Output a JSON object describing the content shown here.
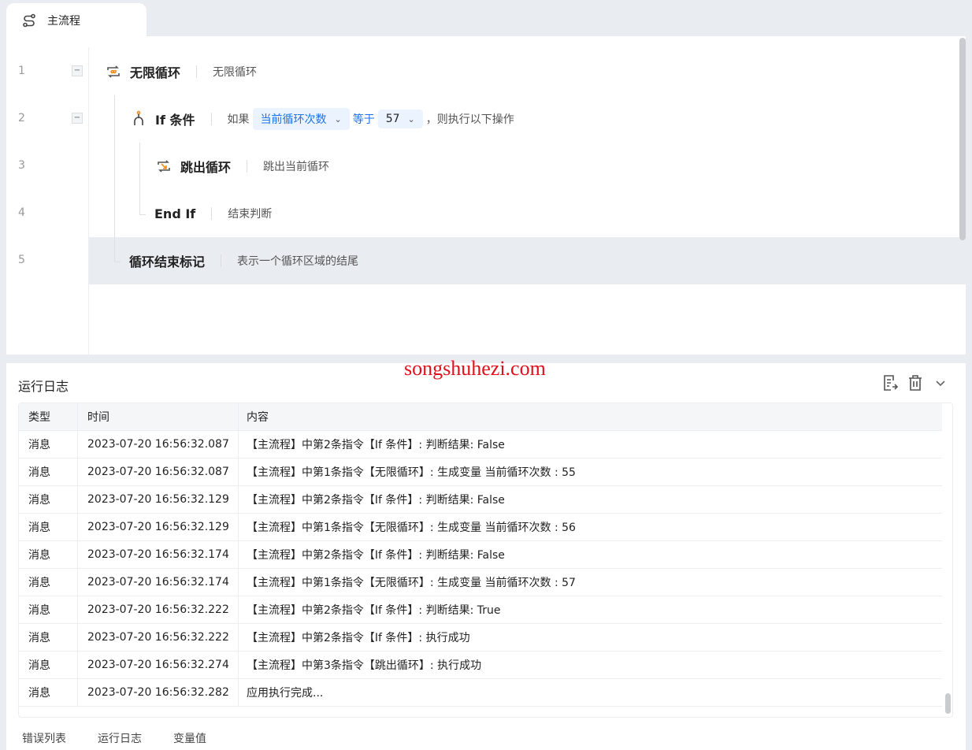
{
  "tab": {
    "label": "主流程",
    "icon": "flow-icon"
  },
  "editor": {
    "rows": [
      {
        "line": "1",
        "name": "无限循环",
        "desc": "无限循环",
        "icon": "infinite-loop-icon"
      },
      {
        "line": "2",
        "name": "If 条件",
        "if_prefix": "如果",
        "var": "当前循环次数",
        "op": "等于",
        "value": "57",
        "suffix": "，则执行以下操作",
        "icon": "branch-icon"
      },
      {
        "line": "3",
        "name": "跳出循环",
        "desc": "跳出当前循环",
        "icon": "break-loop-icon"
      },
      {
        "line": "4",
        "name": "End If",
        "desc": "结束判断"
      },
      {
        "line": "5",
        "name": "循环结束标记",
        "desc": "表示一个循环区域的结尾"
      }
    ]
  },
  "log": {
    "title": "运行日志",
    "watermark": "songshuhezi.com",
    "columns": [
      "类型",
      "时间",
      "内容"
    ],
    "rows": [
      [
        "消息",
        "2023-07-20 16:56:32.087",
        "【主流程】中第2条指令【If 条件】: 判断结果:  False"
      ],
      [
        "消息",
        "2023-07-20 16:56:32.087",
        "【主流程】中第1条指令【无限循环】: 生成变量 当前循环次数 : 55"
      ],
      [
        "消息",
        "2023-07-20 16:56:32.129",
        "【主流程】中第2条指令【If 条件】: 判断结果:  False"
      ],
      [
        "消息",
        "2023-07-20 16:56:32.129",
        "【主流程】中第1条指令【无限循环】: 生成变量 当前循环次数 : 56"
      ],
      [
        "消息",
        "2023-07-20 16:56:32.174",
        "【主流程】中第2条指令【If 条件】: 判断结果:  False"
      ],
      [
        "消息",
        "2023-07-20 16:56:32.174",
        "【主流程】中第1条指令【无限循环】: 生成变量 当前循环次数 : 57"
      ],
      [
        "消息",
        "2023-07-20 16:56:32.222",
        "【主流程】中第2条指令【If 条件】: 判断结果:  True"
      ],
      [
        "消息",
        "2023-07-20 16:56:32.222",
        "【主流程】中第2条指令【If 条件】: 执行成功"
      ],
      [
        "消息",
        "2023-07-20 16:56:32.274",
        "【主流程】中第3条指令【跳出循环】: 执行成功"
      ],
      [
        "消息",
        "2023-07-20 16:56:32.282",
        "应用执行完成..."
      ]
    ]
  },
  "bottom_tabs": [
    "错误列表",
    "运行日志",
    "变量值"
  ],
  "colors": {
    "accent": "#1a73e8",
    "icon_orange": "#f08c1c",
    "watermark": "#e0101a"
  }
}
